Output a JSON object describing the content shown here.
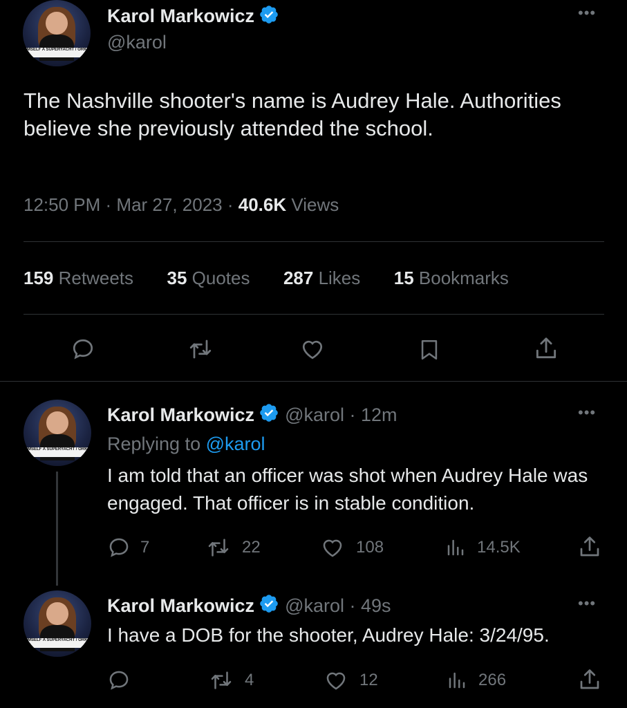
{
  "main_tweet": {
    "author_name": "Karol Markowicz",
    "handle": "@karol",
    "text": "The Nashville shooter's name is Audrey Hale. Authorities believe she previously attended the school.",
    "time": "12:50 PM",
    "date": "Mar 27, 2023",
    "views_count": "40.6K",
    "views_label": "Views",
    "stats": {
      "retweets_count": "159",
      "retweets_label": "Retweets",
      "quotes_count": "35",
      "quotes_label": "Quotes",
      "likes_count": "287",
      "likes_label": "Likes",
      "bookmarks_count": "15",
      "bookmarks_label": "Bookmarks"
    },
    "avatar_chyron": "HIMSELF A SUPERYACHT / ORKERS PEE IN BOTTLE"
  },
  "reply1": {
    "author_name": "Karol Markowicz",
    "handle": "@karol",
    "age": "12m",
    "replying_label": "Replying to",
    "replying_handle": "@karol",
    "text": "I am told that an officer was shot when Audrey Hale was engaged. That officer is in stable condition.",
    "replies": "7",
    "retweets": "22",
    "likes": "108",
    "views": "14.5K"
  },
  "reply2": {
    "author_name": "Karol Markowicz",
    "handle": "@karol",
    "age": "49s",
    "text": "I have a DOB for the shooter, Audrey Hale: 3/24/95.",
    "replies": "",
    "retweets": "4",
    "likes": "12",
    "views": "266"
  },
  "colors": {
    "background": "#000000",
    "text": "#e7e9ea",
    "muted": "#71767b",
    "accent": "#1d9bf0",
    "divider": "#2f3336"
  },
  "icons": [
    "verified-badge-icon",
    "more-icon",
    "reply-icon",
    "retweet-icon",
    "like-icon",
    "bookmark-icon",
    "share-icon",
    "views-icon"
  ]
}
